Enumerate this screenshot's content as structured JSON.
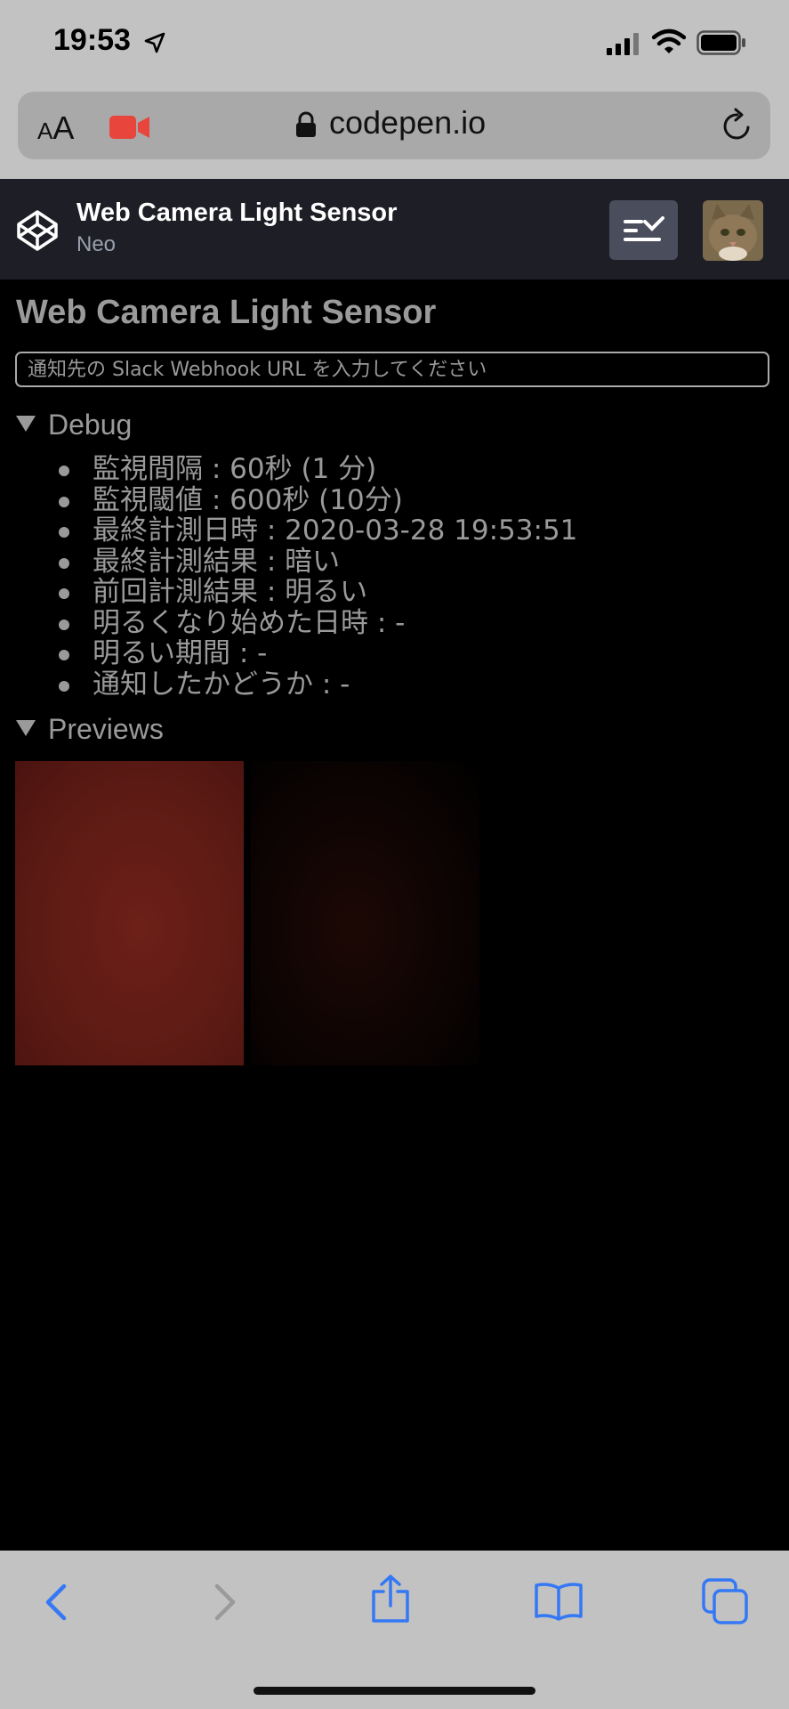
{
  "status_bar": {
    "time": "19:53"
  },
  "browser": {
    "aa_small": "A",
    "aa_large": "A",
    "domain": "codepen.io"
  },
  "codepen": {
    "pen_title": "Web Camera Light Sensor",
    "author": "Neo"
  },
  "page": {
    "title": "Web Camera Light Sensor",
    "webhook_placeholder": "通知先の Slack Webhook URL を入力してください",
    "debug": {
      "summary": "Debug",
      "items": [
        "監視間隔 : 60秒 (1 分)",
        "監視閾値 : 600秒 (10分)",
        "最終計測日時 : 2020-03-28 19:53:51",
        "最終計測結果 : 暗い",
        "前回計測結果 : 明るい",
        "明るくなり始めた日時 : -",
        "明るい期間 : -",
        "通知したかどうか : -"
      ]
    },
    "previews": {
      "summary": "Previews"
    }
  },
  "colors": {
    "accent_blue": "#3478f6",
    "camera_red": "#e8453c",
    "codepen_header": "#1e1f26"
  },
  "icons": [
    "location-arrow-icon",
    "signal-icon",
    "wifi-icon",
    "battery-icon",
    "camera-icon",
    "lock-icon",
    "reload-icon",
    "codepen-logo-icon",
    "view-switcher-icon",
    "back-icon",
    "forward-icon",
    "share-icon",
    "bookmarks-icon",
    "tabs-icon"
  ]
}
